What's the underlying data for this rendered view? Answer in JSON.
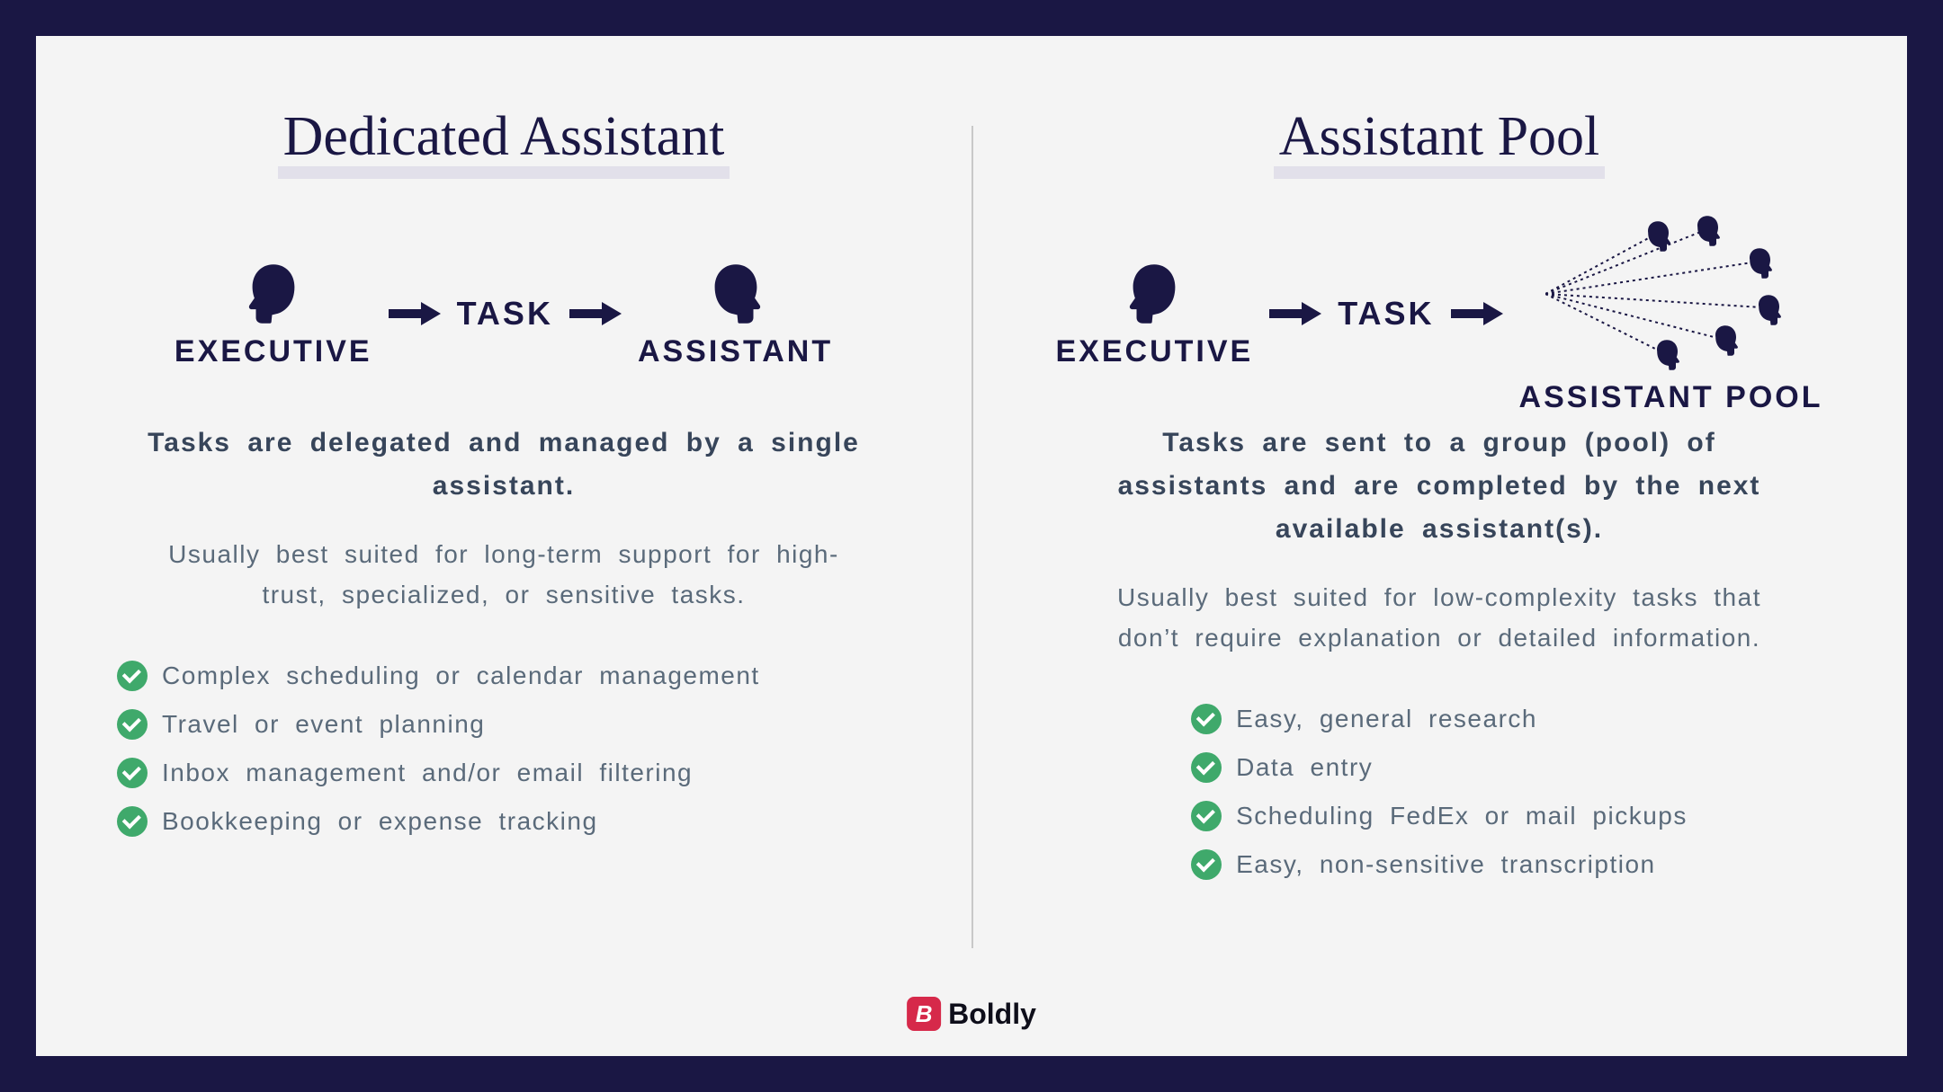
{
  "left": {
    "title": "Dedicated Assistant",
    "executive_label": "EXECUTIVE",
    "task_label": "TASK",
    "assistant_label": "ASSISTANT",
    "desc_bold": "Tasks are delegated and managed by a single assistant.",
    "desc_light": "Usually best suited for long-term support for high-trust, specialized, or sensitive tasks.",
    "bullets": [
      "Complex scheduling or calendar management",
      "Travel or event planning",
      "Inbox management and/or email filtering",
      "Bookkeeping or expense tracking"
    ]
  },
  "right": {
    "title": "Assistant Pool",
    "executive_label": "EXECUTIVE",
    "task_label": "TASK",
    "pool_label": "ASSISTANT POOL",
    "desc_bold": "Tasks are sent to a group (pool) of assistants and are completed by the next available assistant(s).",
    "desc_light": "Usually best suited for low-complexity tasks that don’t require explanation or detailed information.",
    "bullets": [
      "Easy, general research",
      "Data entry",
      "Scheduling FedEx or mail pickups",
      "Easy, non-sensitive transcription"
    ]
  },
  "brand": {
    "mark": "B",
    "name": "Boldly"
  },
  "colors": {
    "navy": "#1a1744",
    "bg": "#f4f4f4",
    "text": "#37455a",
    "muted": "#5a6a7a",
    "green": "#3fa96b",
    "red": "#d6294a"
  }
}
